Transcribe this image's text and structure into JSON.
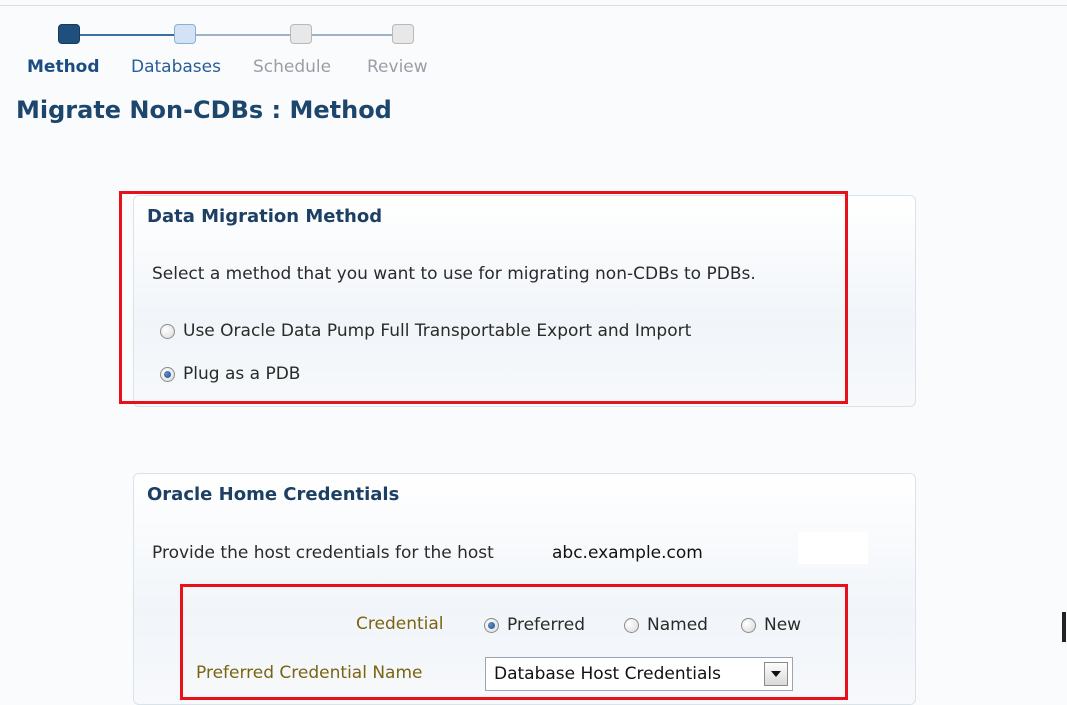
{
  "train": {
    "steps": [
      {
        "label": "Method",
        "state": "current"
      },
      {
        "label": "Databases",
        "state": "next"
      },
      {
        "label": "Schedule",
        "state": "future"
      },
      {
        "label": "Review",
        "state": "future"
      }
    ]
  },
  "page": {
    "title": "Migrate Non-CDBs : Method"
  },
  "migration_panel": {
    "header": "Data Migration Method",
    "instruction": "Select a method that you want to use for migrating non-CDBs to PDBs.",
    "options": [
      {
        "label": "Use Oracle Data Pump Full Transportable Export and Import",
        "checked": false
      },
      {
        "label": "Plug as a PDB",
        "checked": true
      }
    ]
  },
  "credentials_panel": {
    "header": "Oracle Home Credentials",
    "instruction": "Provide the host credentials for the host",
    "host": "abc.example.com",
    "credential_label": "Credential",
    "credential_options": [
      {
        "label": "Preferred",
        "checked": true
      },
      {
        "label": "Named",
        "checked": false
      },
      {
        "label": "New",
        "checked": false
      }
    ],
    "preferred_name_label": "Preferred Credential Name",
    "preferred_name_value": "Database Host Credentials"
  },
  "colors": {
    "highlight_box": "#e8101a",
    "title": "#1d466d",
    "current_step": "#1f4f7c",
    "field_label": "#7a6411"
  }
}
